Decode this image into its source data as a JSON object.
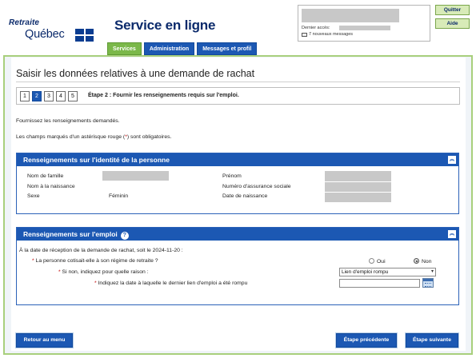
{
  "header": {
    "logo_line1": "Retraite",
    "logo_line2": "Québec",
    "site_title": "Service en ligne",
    "last_access_label": "Dernier accès:",
    "new_messages": "7 nouveaux messages",
    "quit_label": "Quitter",
    "help_label": "Aide"
  },
  "tabs": [
    {
      "label": "Services",
      "active": true
    },
    {
      "label": "Administration",
      "active": false
    },
    {
      "label": "Messages et profil",
      "active": false
    }
  ],
  "page": {
    "heading": "Saisir les données relatives à une demande de rachat",
    "steps": [
      "1",
      "2",
      "3",
      "4",
      "5"
    ],
    "current_step": 2,
    "step_label": "Étape 2 : Fournir les renseignements requis sur l'emploi.",
    "intro1": "Fournissez les renseignements demandés.",
    "intro2_before": "Les champs marqués d'un astérisque rouge (",
    "intro2_star": "*",
    "intro2_after": ") sont obligatoires."
  },
  "identity": {
    "title": "Renseignements sur l'identité de la personne",
    "collapse_icon": "chevron-up-icon",
    "last_name_label": "Nom de famille",
    "birth_name_label": "Nom à la naissance",
    "sex_label": "Sexe",
    "sex_value": "Féminin",
    "first_name_label": "Prénom",
    "sin_label": "Numéro d'assurance sociale",
    "birthdate_label": "Date de naissance"
  },
  "employment": {
    "title": "Renseignements sur l'emploi",
    "intro": "À la date de réception de la demande de rachat, soit le 2024-11-20 :",
    "q1": "La personne cotisait-elle à son régime de retraite ?",
    "q1_yes": "Oui",
    "q1_no": "Non",
    "q1_selected": "Non",
    "q2": "Si non, indiquez pour quelle raison :",
    "q2_value": "Lien d'emploi rompu",
    "q3": "Indiquez la date à laquelle le dernier lien d'emploi a été rompu",
    "q3_value": "",
    "required_mark": "*"
  },
  "footer": {
    "back_menu": "Retour au menu",
    "prev_step": "Étape précédente",
    "next_step": "Étape suivante"
  },
  "colors": {
    "brand_blue": "#1c58b3",
    "tab_active_green": "#7bb84a",
    "frame_green": "#a8cf7c",
    "required_red": "#c00000"
  }
}
